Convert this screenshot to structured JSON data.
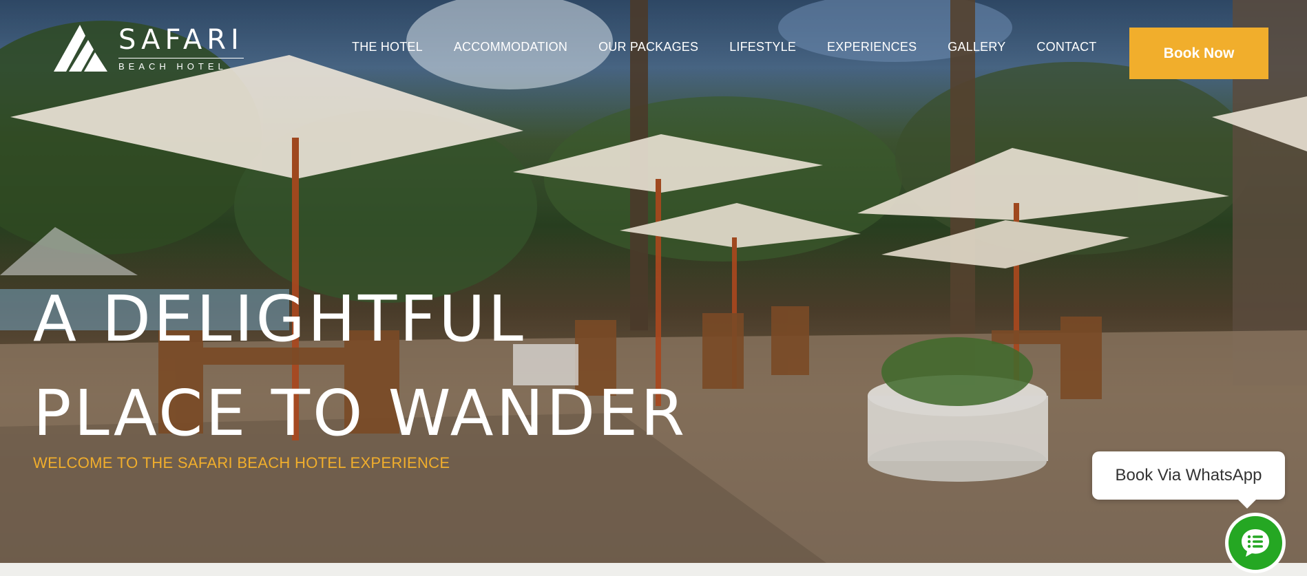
{
  "brand": {
    "title": "SAFARI",
    "subtitle": "BEACH HOTEL"
  },
  "nav": {
    "items": [
      {
        "label": "THE HOTEL"
      },
      {
        "label": "ACCOMMODATION"
      },
      {
        "label": "OUR PACKAGES"
      },
      {
        "label": "LIFESTYLE"
      },
      {
        "label": "EXPERIENCES"
      },
      {
        "label": "GALLERY"
      },
      {
        "label": "CONTACT"
      }
    ]
  },
  "header": {
    "book_label": "Book Now"
  },
  "hero": {
    "headline_line1": "A DELIGHTFUL",
    "headline_line2": "PLACE TO WANDER",
    "tagline": "WELCOME TO THE SAFARI BEACH HOTEL EXPERIENCE"
  },
  "whatsapp": {
    "label": "Book Via WhatsApp",
    "icon": "chat-list-icon"
  },
  "colors": {
    "accent": "#f1ae2c",
    "whatsapp_green": "#25a723",
    "text_light": "#ffffff"
  }
}
